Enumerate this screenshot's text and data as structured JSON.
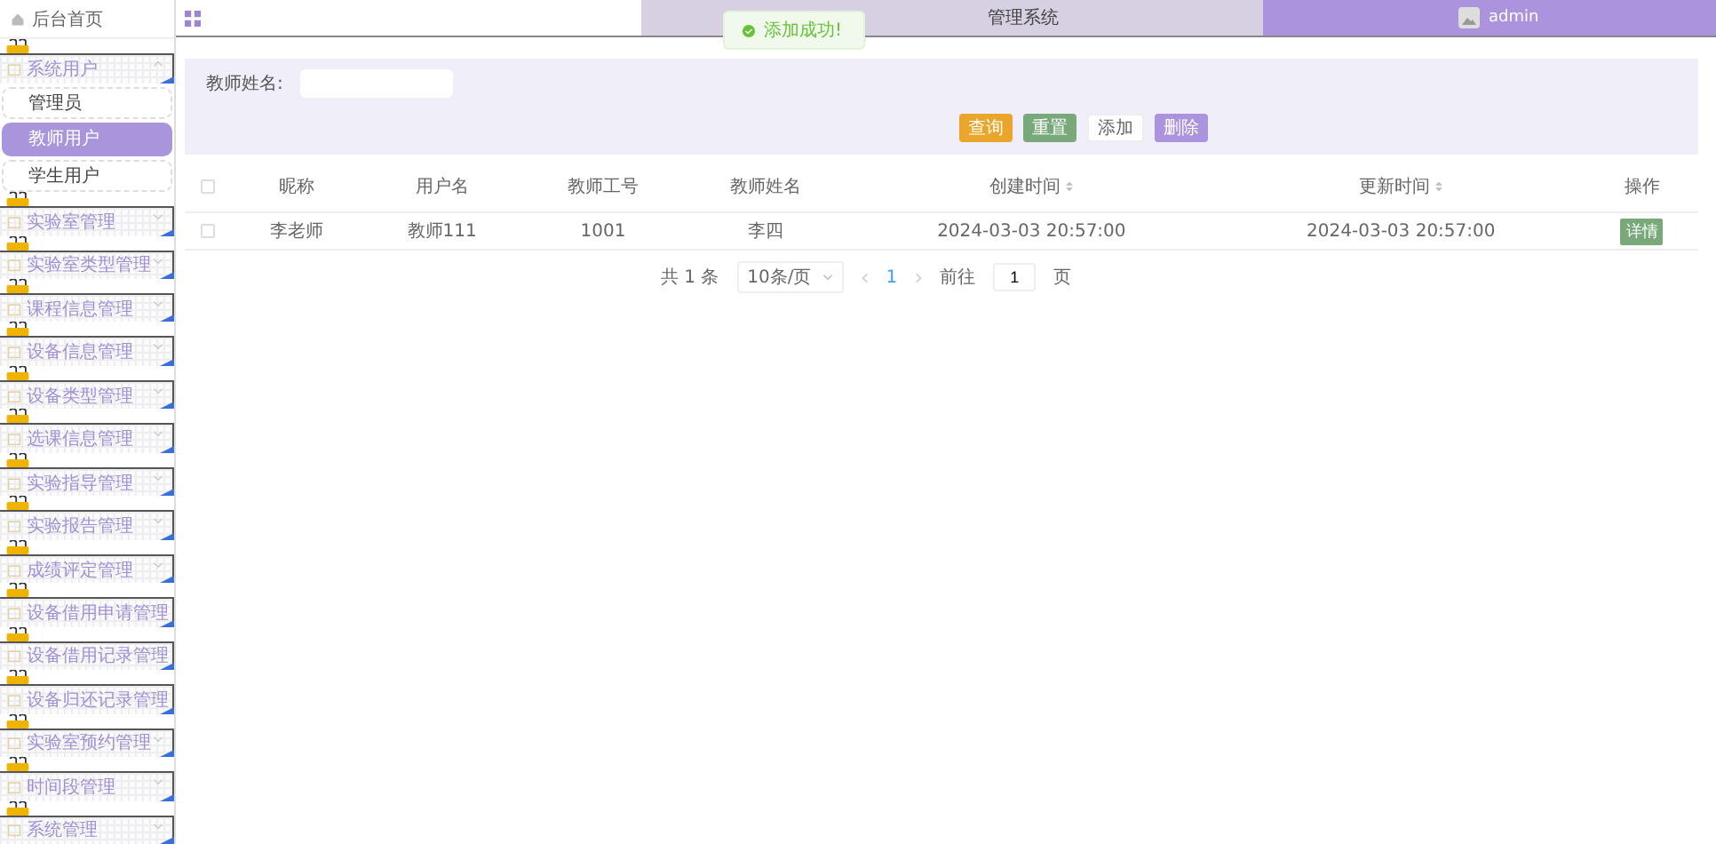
{
  "header": {
    "title": "管理系统",
    "user": "admin"
  },
  "toast": {
    "text": "添加成功!"
  },
  "sidebar": {
    "items": [
      {
        "kind": "home",
        "label": "后台首页"
      },
      {
        "kind": "group",
        "label": "系统用户",
        "expanded": true,
        "children": [
          {
            "label": "管理员",
            "selected": false
          },
          {
            "label": "教师用户",
            "selected": true
          },
          {
            "label": "学生用户",
            "selected": false
          }
        ]
      },
      {
        "kind": "group",
        "label": "实验室管理",
        "expanded": false
      },
      {
        "kind": "group",
        "label": "实验室类型管理",
        "expanded": false
      },
      {
        "kind": "group",
        "label": "课程信息管理",
        "expanded": false
      },
      {
        "kind": "group",
        "label": "设备信息管理",
        "expanded": false
      },
      {
        "kind": "group",
        "label": "设备类型管理",
        "expanded": false
      },
      {
        "kind": "group",
        "label": "选课信息管理",
        "expanded": false
      },
      {
        "kind": "group",
        "label": "实验指导管理",
        "expanded": false
      },
      {
        "kind": "group",
        "label": "实验报告管理",
        "expanded": false
      },
      {
        "kind": "group",
        "label": "成绩评定管理",
        "expanded": false
      },
      {
        "kind": "group",
        "label": "设备借用申请管理",
        "expanded": false
      },
      {
        "kind": "group",
        "label": "设备借用记录管理",
        "expanded": false
      },
      {
        "kind": "group",
        "label": "设备归还记录管理",
        "expanded": false
      },
      {
        "kind": "group",
        "label": "实验室预约管理",
        "expanded": false
      },
      {
        "kind": "group",
        "label": "时间段管理",
        "expanded": false
      },
      {
        "kind": "group",
        "label": "系统管理",
        "expanded": false
      }
    ]
  },
  "search": {
    "label": "教师姓名:"
  },
  "buttons": [
    {
      "label": "查询",
      "kind": "query"
    },
    {
      "label": "重置",
      "kind": "reset"
    },
    {
      "label": "添加",
      "kind": "add"
    },
    {
      "label": "删除",
      "kind": "delete"
    }
  ],
  "table": {
    "select_all": {
      "checked": false
    },
    "columns": [
      {
        "label": "昵称",
        "kind": "plain"
      },
      {
        "label": "用户名",
        "kind": "plain"
      },
      {
        "label": "教师工号",
        "kind": "plain"
      },
      {
        "label": "教师姓名",
        "kind": "plain"
      },
      {
        "label": "创建时间",
        "kind": "sortable"
      },
      {
        "label": "更新时间",
        "kind": "sortable"
      },
      {
        "label": "操作",
        "kind": "plain"
      }
    ],
    "rows": [
      {
        "checked": false,
        "cells": [
          "李老师",
          "教师111",
          "1001",
          "李四",
          "2024-03-03 20:57:00",
          "2024-03-03 20:57:00"
        ],
        "action": "详情"
      }
    ]
  },
  "pagination": {
    "total": "共 1 条",
    "page_size": "10条/页",
    "pages": [
      {
        "label": "1",
        "selected": true
      }
    ],
    "jump_label": "前往",
    "jump_value": "1",
    "page_suffix": "页"
  }
}
